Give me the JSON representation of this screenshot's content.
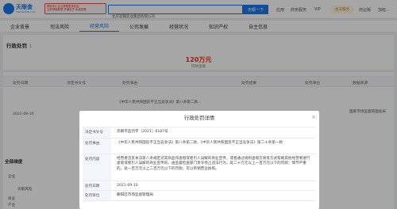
{
  "header": {
    "logo_text": "天眼查",
    "logo_sub": "TianYanCha.com",
    "promo_lines": [
      "帮助中小企业获取更多机会",
      "立即领取数据 开通会员 免费查看"
    ],
    "search_value": "北京首钢实业集团有限公司",
    "search_button": "天眼一下",
    "nav_items": [
      "应用",
      "商务服务",
      "VIP"
    ],
    "vip_label": "会员服务",
    "user_links": [
      "商业版",
      "加班..."
    ]
  },
  "tabs": [
    {
      "label": "企业背景",
      "count": ""
    },
    {
      "label": "司法风险",
      "count": ""
    },
    {
      "label": "经营风险",
      "count": ""
    },
    {
      "label": "公司发展",
      "count": ""
    },
    {
      "label": "经营状况",
      "count": ""
    },
    {
      "label": "知识产权",
      "count": ""
    },
    {
      "label": "自主信息",
      "count": ""
    }
  ],
  "section": {
    "title": "行政处罚",
    "count": "1",
    "amount": "120万元",
    "amount_label": "罚款金额"
  },
  "table": {
    "headers": [
      "处罚日期",
      "决定书文号",
      "处罚事由",
      "处罚结果",
      "处罚单位",
      "数据来源"
    ],
    "row": {
      "date": "2021-09-10",
      "reason_snippet": "《中华人民共和国反不正当竞争法》第八条第二款...",
      "unit": "国家市场监督管理总局"
    }
  },
  "sidebar": {
    "section_title": "全部维度",
    "items": [
      "企业",
      "天眼风险",
      "商业",
      "产业"
    ]
  },
  "modal": {
    "title": "行政处罚详情",
    "close_icon": "close-icon",
    "rows": [
      {
        "key": "决定书文号",
        "value": "京朝市监罚字〔2021〕6187号"
      },
      {
        "key": "处罚事由",
        "value": "《中华人民共和国反不正当竞争法》第八条第二款、《中华人民共和国反不正当竞争法》第二十条第一款"
      },
      {
        "key": "处罚内容",
        "value": "经营者违反本法第八条规定对其商品作虚假或者引人误解的商业宣传，或者通过组织虚假交易等方式帮助其他经营者进行虚假或者引人误解的商业宣传的，由监督检查部门责令停止违法行为，处二十万元以上一百万元以下的罚款；情节严重的，处一百万元以上二百万元以下的罚款，可以吊销营业执照。"
      },
      {
        "key": "处罚日期",
        "value": "2021-09-10"
      },
      {
        "key": "处罚单位",
        "value": "朝阳区市场监督管理局"
      }
    ]
  }
}
